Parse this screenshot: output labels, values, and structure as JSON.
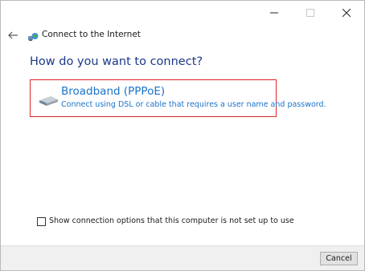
{
  "window": {
    "title": "Connect to the Internet",
    "caption_buttons": [
      "minimize-icon",
      "maximize-icon",
      "close-icon"
    ]
  },
  "nav": {
    "back_icon": "back-arrow-icon",
    "header_icon": "network-globe-icon"
  },
  "main": {
    "heading": "How do you want to connect?",
    "options": [
      {
        "title": "Broadband (PPPoE)",
        "description": "Connect using DSL or cable that requires a user name and password.",
        "icon": "broadband-modem-icon",
        "selected": true
      }
    ]
  },
  "checkbox": {
    "label": "Show connection options that this computer is not set up to use",
    "checked": false
  },
  "footer": {
    "cancel_label": "Cancel"
  },
  "colors": {
    "heading": "#1a3a86",
    "link": "#1a73c9",
    "selection_border": "#e0242a",
    "footer_bg": "#f0f0f0"
  }
}
